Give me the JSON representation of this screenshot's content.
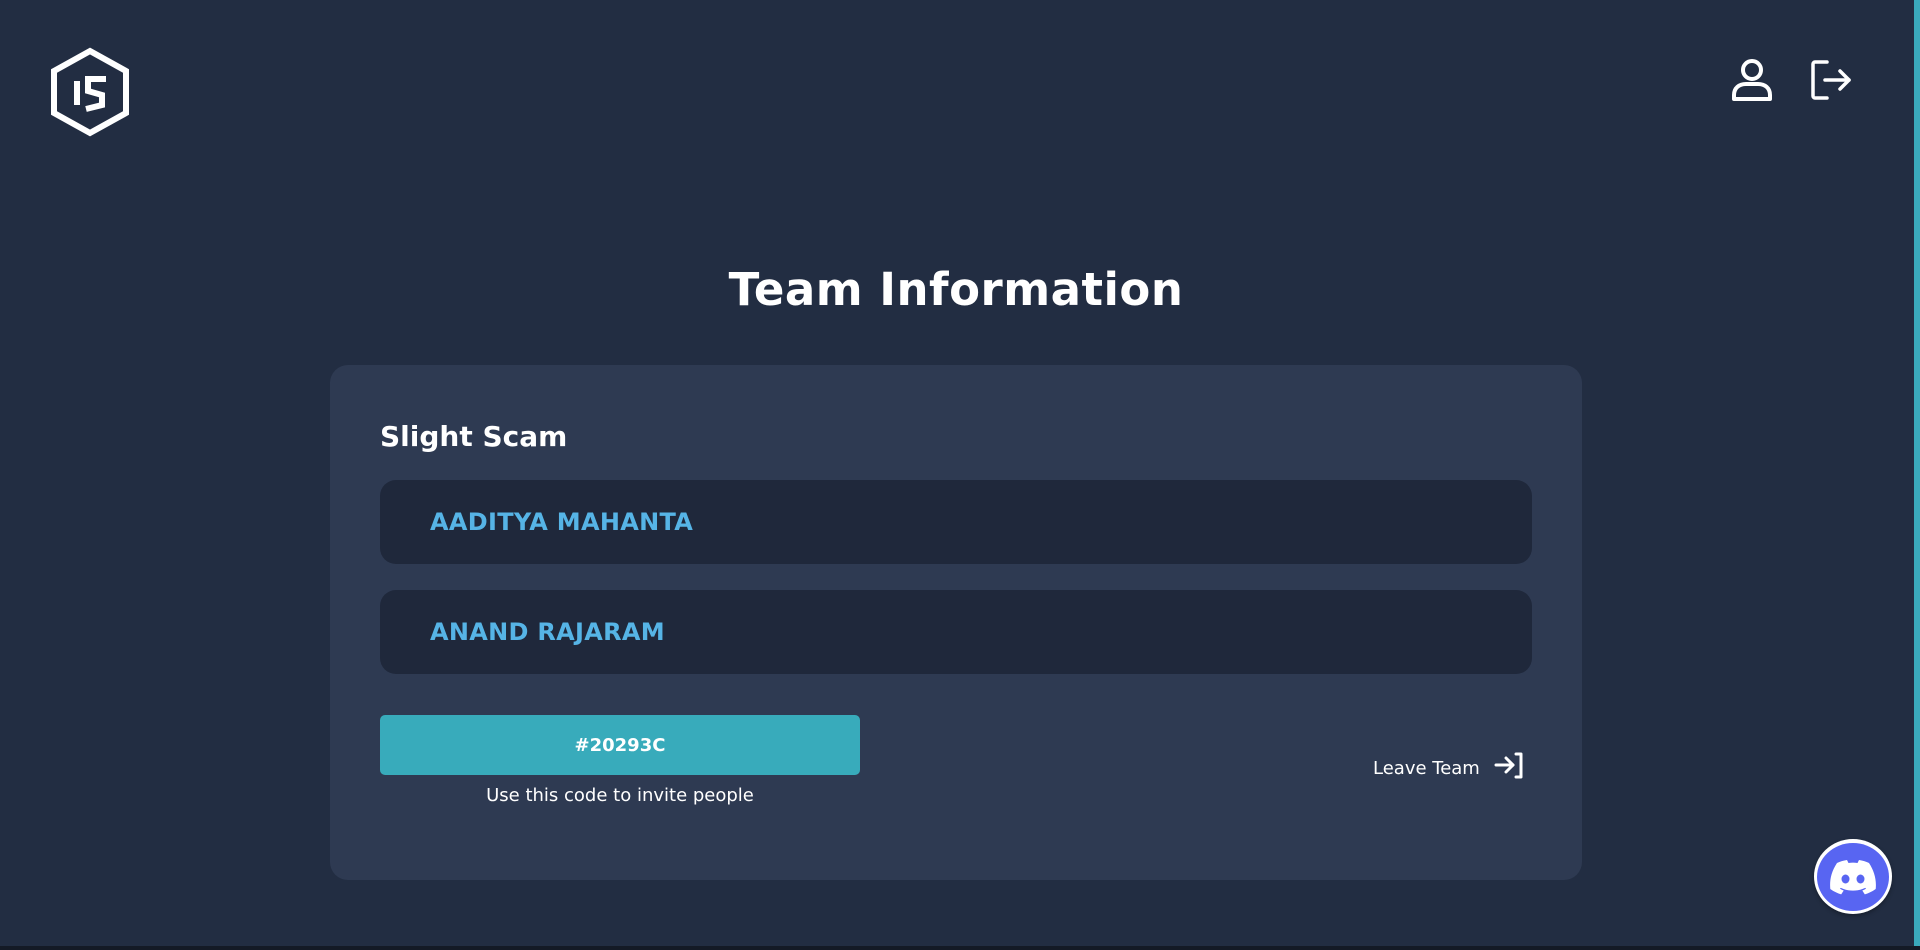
{
  "header": {
    "logo_icon": "hexagon-logo-icon",
    "profile_icon": "user-icon",
    "logout_icon": "logout-icon"
  },
  "main": {
    "title": "Team Information"
  },
  "team": {
    "name": "Slight Scam",
    "members": [
      {
        "name": "AADITYA MAHANTA"
      },
      {
        "name": "ANAND RAJARAM"
      }
    ],
    "invite_code": "#20293C",
    "invite_hint": "Use this code to invite people",
    "leave_label": "Leave Team",
    "leave_icon": "leave-arrow-icon"
  },
  "floating": {
    "discord_icon": "discord-icon"
  },
  "colors": {
    "background": "#222d42",
    "card": "#2e3a52",
    "member_row": "#1f283b",
    "member_name": "#56b4e6",
    "accent": "#38abbb",
    "discord": "#5865f2"
  }
}
